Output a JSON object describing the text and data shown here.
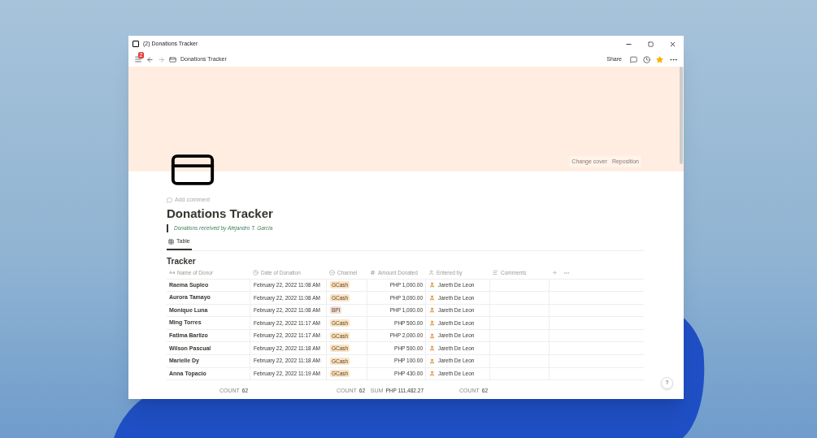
{
  "window": {
    "title": "(2) Donations Tracker"
  },
  "toolbar": {
    "notification_count": "2",
    "breadcrumb": "Donations Tracker",
    "share": "Share",
    "favorite": true
  },
  "cover": {
    "buttons": [
      "Change cover",
      "Reposition"
    ]
  },
  "page": {
    "add_comment": "Add comment",
    "title": "Donations Tracker",
    "quote": "Donations received by Alejandro T. Garcia"
  },
  "views": [
    {
      "label": "Table",
      "selected": true
    }
  ],
  "table": {
    "title": "Tracker",
    "columns": [
      {
        "label": "Name of Donor",
        "kind": "title",
        "summary": {
          "label": "COUNT",
          "value": "62"
        }
      },
      {
        "label": "Date of Donation",
        "kind": "date"
      },
      {
        "label": "Channel",
        "kind": "select",
        "summary": {
          "label": "COUNT",
          "value": "62"
        }
      },
      {
        "label": "Amount Donated",
        "kind": "number",
        "summary": {
          "label": "SUM",
          "value": "PHP 111,482.27"
        }
      },
      {
        "label": "Entered by",
        "kind": "person",
        "summary": {
          "label": "COUNT",
          "value": "62"
        }
      },
      {
        "label": "Comments",
        "kind": "text"
      }
    ],
    "rows": [
      {
        "name": "Raema Supleo",
        "date": "February 22, 2022 11:08 AM",
        "channel": {
          "label": "GCash",
          "color": "#fbe4c4"
        },
        "amount": "PHP 1,000.00",
        "entered_by": "Jareth De Leon"
      },
      {
        "name": "Aurora Tamayo",
        "date": "February 22, 2022 11:08 AM",
        "channel": {
          "label": "GCash",
          "color": "#fbe4c4"
        },
        "amount": "PHP 3,000.00",
        "entered_by": "Jareth De Leon"
      },
      {
        "name": "Monique Luna",
        "date": "February 22, 2022 11:08 AM",
        "channel": {
          "label": "BPI",
          "color": "#f2ded9"
        },
        "amount": "PHP 1,000.00",
        "entered_by": "Jareth De Leon"
      },
      {
        "name": "Ming Torres",
        "date": "February 22, 2022 11:17 AM",
        "channel": {
          "label": "GCash",
          "color": "#fbe4c4"
        },
        "amount": "PHP 500.00",
        "entered_by": "Jareth De Leon"
      },
      {
        "name": "Fatima Barlizo",
        "date": "February 22, 2022 11:17 AM",
        "channel": {
          "label": "GCash",
          "color": "#fbe4c4"
        },
        "amount": "PHP 2,000.00",
        "entered_by": "Jareth De Leon"
      },
      {
        "name": "Wilson Pascual",
        "date": "February 22, 2022 11:18 AM",
        "channel": {
          "label": "GCash",
          "color": "#fbe4c4"
        },
        "amount": "PHP 500.00",
        "entered_by": "Jareth De Leon"
      },
      {
        "name": "Marielle Dy",
        "date": "February 22, 2022 11:18 AM",
        "channel": {
          "label": "GCash",
          "color": "#fbe4c4"
        },
        "amount": "PHP 100.00",
        "entered_by": "Jareth De Leon"
      },
      {
        "name": "Anna Topacio",
        "date": "February 22, 2022 11:19 AM",
        "channel": {
          "label": "GCash",
          "color": "#fbe4c4"
        },
        "amount": "PHP 430.00",
        "entered_by": "Jareth De Leon"
      }
    ]
  },
  "help": "?"
}
